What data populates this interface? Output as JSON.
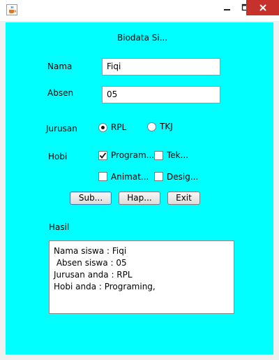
{
  "window": {
    "icon": "java-cup-icon",
    "close_color": "#c7312b"
  },
  "form": {
    "title": "Biodata Si...",
    "nama_label": "Nama",
    "nama_value": "Fiqi",
    "absen_label": "Absen",
    "absen_value": "05",
    "jurusan_label": "Jurusan",
    "jurusan_options": [
      {
        "label": "RPL",
        "selected": true
      },
      {
        "label": "TKJ",
        "selected": false
      }
    ],
    "hobi_label": "Hobi",
    "hobi_options": [
      {
        "label": "Program...",
        "checked": true
      },
      {
        "label": "Tek...",
        "checked": false
      },
      {
        "label": "Animat...",
        "checked": false
      },
      {
        "label": "Desig...",
        "checked": false
      }
    ],
    "buttons": {
      "submit": "Sub...",
      "hapus": "Hap...",
      "exit": "Exit"
    },
    "hasil_label": "Hasil",
    "hasil_lines": [
      "Nama siswa : Fiqi",
      " Absen siswa : 05",
      "Jurusan anda : RPL",
      "Hobi anda : Programing,"
    ]
  },
  "colors": {
    "background": "#00ffff",
    "field_border": "#7a9cc6"
  }
}
